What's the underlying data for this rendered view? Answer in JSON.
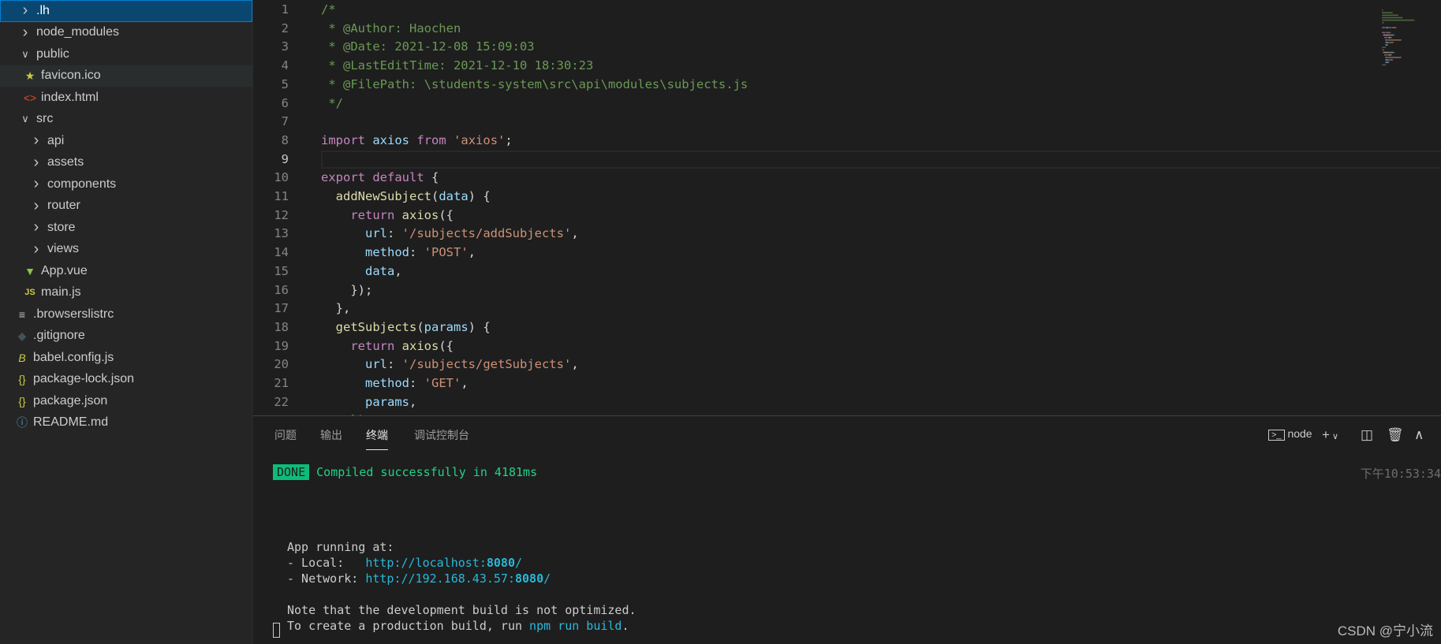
{
  "explorer": [
    {
      "label": ".lh",
      "type": "folder",
      "open": false,
      "depth": 0,
      "selected": true
    },
    {
      "label": "node_modules",
      "type": "folder",
      "open": false,
      "depth": 0
    },
    {
      "label": "public",
      "type": "folder",
      "open": true,
      "depth": 0
    },
    {
      "label": "favicon.ico",
      "type": "file",
      "icon": "star-icon",
      "color": "#cbcb41",
      "depth": 1,
      "hover": true
    },
    {
      "label": "index.html",
      "type": "file",
      "icon": "html-icon",
      "color": "#e44d26",
      "depth": 1
    },
    {
      "label": "src",
      "type": "folder",
      "open": true,
      "depth": 0
    },
    {
      "label": "api",
      "type": "folder",
      "open": false,
      "depth": 1
    },
    {
      "label": "assets",
      "type": "folder",
      "open": false,
      "depth": 1
    },
    {
      "label": "components",
      "type": "folder",
      "open": false,
      "depth": 1
    },
    {
      "label": "router",
      "type": "folder",
      "open": false,
      "depth": 1
    },
    {
      "label": "store",
      "type": "folder",
      "open": false,
      "depth": 1
    },
    {
      "label": "views",
      "type": "folder",
      "open": false,
      "depth": 1
    },
    {
      "label": "App.vue",
      "type": "file",
      "icon": "vue-icon",
      "color": "#8dc149",
      "depth": 1
    },
    {
      "label": "main.js",
      "type": "file",
      "icon": "js-icon",
      "color": "#cbcb41",
      "depth": 1
    },
    {
      "label": ".browserslistrc",
      "type": "file",
      "icon": "lines-icon",
      "color": "#c5c5c5",
      "depth": 0
    },
    {
      "label": ".gitignore",
      "type": "file",
      "icon": "git-icon",
      "color": "#41535b",
      "depth": 0
    },
    {
      "label": "babel.config.js",
      "type": "file",
      "icon": "babel-icon",
      "color": "#cbcb41",
      "depth": 0
    },
    {
      "label": "package-lock.json",
      "type": "file",
      "icon": "json-icon",
      "color": "#cbcb41",
      "depth": 0
    },
    {
      "label": "package.json",
      "type": "file",
      "icon": "json-icon",
      "color": "#cbcb41",
      "depth": 0
    },
    {
      "label": "README.md",
      "type": "file",
      "icon": "info-icon",
      "color": "#519aba",
      "depth": 0
    }
  ],
  "editor": {
    "current_line": 9,
    "lines": [
      [
        [
          "c",
          "/*"
        ]
      ],
      [
        [
          "c",
          " * @Author: Haochen"
        ]
      ],
      [
        [
          "c",
          " * @Date: 2021-12-08 15:09:03"
        ]
      ],
      [
        [
          "c",
          " * @LastEditTime: 2021-12-10 18:30:23"
        ]
      ],
      [
        [
          "c",
          " * @FilePath: \\students-system\\src\\api\\modules\\subjects.js"
        ]
      ],
      [
        [
          "c",
          " */"
        ]
      ],
      [],
      [
        [
          "k",
          "import"
        ],
        [
          "p",
          " "
        ],
        [
          "v",
          "axios"
        ],
        [
          "p",
          " "
        ],
        [
          "k",
          "from"
        ],
        [
          "p",
          " "
        ],
        [
          "s",
          "'axios'"
        ],
        [
          "p",
          ";"
        ]
      ],
      [],
      [
        [
          "k",
          "export"
        ],
        [
          "p",
          " "
        ],
        [
          "k",
          "default"
        ],
        [
          "p",
          " {"
        ]
      ],
      [
        [
          "p",
          "  "
        ],
        [
          "f",
          "addNewSubject"
        ],
        [
          "p",
          "("
        ],
        [
          "v",
          "data"
        ],
        [
          "p",
          ") {"
        ]
      ],
      [
        [
          "p",
          "    "
        ],
        [
          "k",
          "return"
        ],
        [
          "p",
          " "
        ],
        [
          "f",
          "axios"
        ],
        [
          "p",
          "({"
        ]
      ],
      [
        [
          "p",
          "      "
        ],
        [
          "v",
          "url"
        ],
        [
          "p",
          ": "
        ],
        [
          "s",
          "'/subjects/addSubjects'"
        ],
        [
          "p",
          ","
        ]
      ],
      [
        [
          "p",
          "      "
        ],
        [
          "v",
          "method"
        ],
        [
          "p",
          ": "
        ],
        [
          "s",
          "'POST'"
        ],
        [
          "p",
          ","
        ]
      ],
      [
        [
          "p",
          "      "
        ],
        [
          "v",
          "data"
        ],
        [
          "p",
          ","
        ]
      ],
      [
        [
          "p",
          "    });"
        ]
      ],
      [
        [
          "p",
          "  },"
        ]
      ],
      [
        [
          "p",
          "  "
        ],
        [
          "f",
          "getSubjects"
        ],
        [
          "p",
          "("
        ],
        [
          "v",
          "params"
        ],
        [
          "p",
          ") {"
        ]
      ],
      [
        [
          "p",
          "    "
        ],
        [
          "k",
          "return"
        ],
        [
          "p",
          " "
        ],
        [
          "f",
          "axios"
        ],
        [
          "p",
          "({"
        ]
      ],
      [
        [
          "p",
          "      "
        ],
        [
          "v",
          "url"
        ],
        [
          "p",
          ": "
        ],
        [
          "s",
          "'/subjects/getSubjects'"
        ],
        [
          "p",
          ","
        ]
      ],
      [
        [
          "p",
          "      "
        ],
        [
          "v",
          "method"
        ],
        [
          "p",
          ": "
        ],
        [
          "s",
          "'GET'"
        ],
        [
          "p",
          ","
        ]
      ],
      [
        [
          "p",
          "      "
        ],
        [
          "v",
          "params"
        ],
        [
          "p",
          ","
        ]
      ],
      [
        [
          "p",
          "    });"
        ]
      ]
    ]
  },
  "panel": {
    "tabs": [
      {
        "label": "问题"
      },
      {
        "label": "输出"
      },
      {
        "label": "终端",
        "active": true
      },
      {
        "label": "调试控制台"
      }
    ],
    "terminal_name": "node",
    "terminal": {
      "done_badge": "DONE",
      "compiled": "Compiled successfully in 4181ms",
      "time": "下午10:53:34",
      "app_running": "App running at:",
      "local_label": "- Local:   ",
      "local_url_pre": "http://localhost:",
      "local_port": "8080",
      "local_url_post": "/",
      "network_label": "- Network: ",
      "network_url_pre": "http://192.168.43.57:",
      "network_port": "8080",
      "network_url_post": "/",
      "note1": "Note that the development build is not optimized.",
      "note2_pre": "To create a production build, run ",
      "note2_cmd": "npm run build",
      "note2_post": "."
    }
  },
  "watermark": "CSDN @宁小流"
}
